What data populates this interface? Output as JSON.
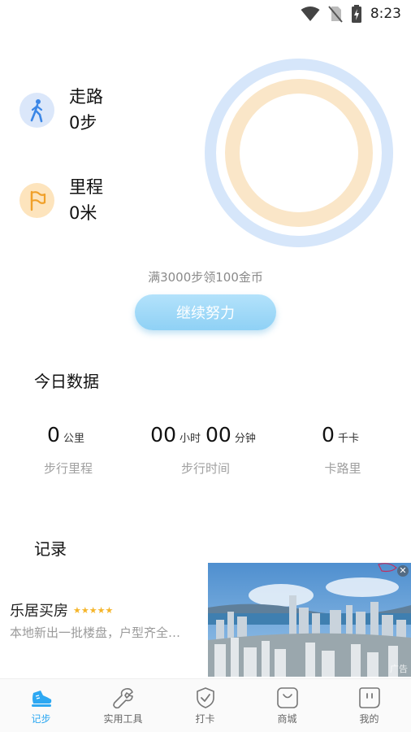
{
  "status_bar": {
    "time": "8:23"
  },
  "metrics": {
    "walk": {
      "label": "走路",
      "value": "0步",
      "icon": "walking-person-icon"
    },
    "distance": {
      "label": "里程",
      "value": "0米",
      "icon": "flag-icon"
    }
  },
  "progress": {
    "goal_text": "满3000步领100金币",
    "continue_label": "继续努力",
    "ring_progress": 0
  },
  "today": {
    "title": "今日数据",
    "distance": {
      "value": "0",
      "unit": "公里",
      "label": "步行里程"
    },
    "time": {
      "hours": "00",
      "hours_unit": "小时",
      "minutes": "00",
      "minutes_unit": "分钟",
      "label": "步行时间"
    },
    "calories": {
      "value": "0",
      "unit": "千卡",
      "label": "卡路里"
    }
  },
  "records": {
    "title": "记录"
  },
  "ad": {
    "title": "乐居买房",
    "stars": "★★★★★",
    "description": "本地新出一批楼盘，户型齐全…",
    "close_icon": "close-icon",
    "brand": "乐居",
    "tag": "广告"
  },
  "nav": {
    "items": [
      {
        "label": "记步",
        "icon": "shoe-icon",
        "active": true
      },
      {
        "label": "实用工具",
        "icon": "wrench-icon",
        "active": false
      },
      {
        "label": "打卡",
        "icon": "shield-check-icon",
        "active": false
      },
      {
        "label": "商城",
        "icon": "shopping-bag-icon",
        "active": false
      },
      {
        "label": "我的",
        "icon": "profile-icon",
        "active": false
      }
    ]
  },
  "colors": {
    "accent": "#2da8f2",
    "ring_outer": "#d6e6fa",
    "ring_inner": "#fae6c8",
    "button": "#a5dbf8"
  }
}
